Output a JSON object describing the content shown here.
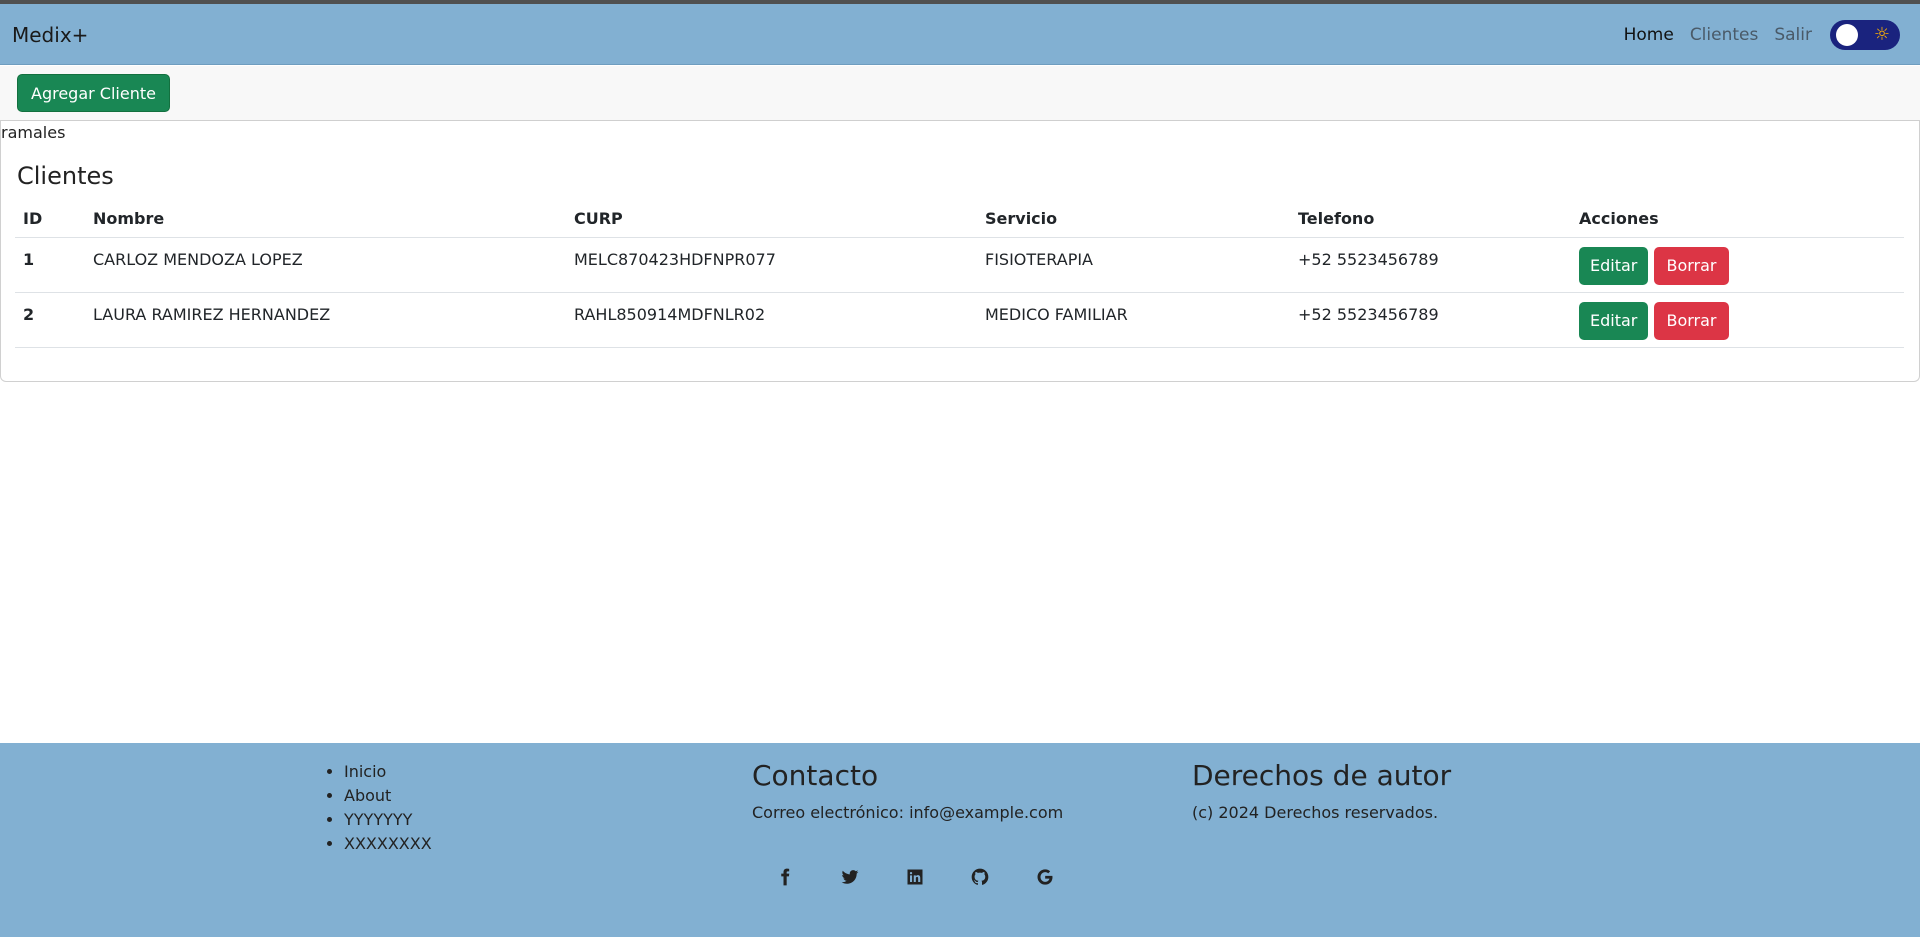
{
  "navbar": {
    "brand": "Medix+",
    "links": [
      "Home",
      "Clientes",
      "Salir"
    ],
    "toggle_icon": "sun-icon"
  },
  "toolbar": {
    "add_label": "Agregar Cliente"
  },
  "user": {
    "name": "ramales"
  },
  "clients": {
    "title": "Clientes",
    "columns": [
      "ID",
      "Nombre",
      "CURP",
      "Servicio",
      "Telefono",
      "Acciones"
    ],
    "rows": [
      {
        "id": "1",
        "nombre": "CARLOZ MENDOZA LOPEZ",
        "curp": "MELC870423HDFNPR077",
        "servicio": "FISIOTERAPIA",
        "telefono": "+52 5523456789",
        "edit": "Editar",
        "delete": "Borrar"
      },
      {
        "id": "2",
        "nombre": "LAURA RAMIREZ HERNANDEZ",
        "curp": "RAHL850914MDFNLR02",
        "servicio": "MEDICO FAMILIAR",
        "telefono": "+52 5523456789",
        "edit": "Editar",
        "delete": "Borrar"
      }
    ]
  },
  "footer": {
    "links": [
      "Inicio",
      "About",
      "YYYYYYY",
      "XXXXXXXX"
    ],
    "contact_title": "Contacto",
    "contact_text": "Correo electrónico: info@example.com",
    "rights_title": "Derechos de autor",
    "rights_text": "(c) 2024 Derechos reservados.",
    "social_icons": [
      "facebook-icon",
      "twitter-icon",
      "linkedin-icon",
      "github-icon",
      "google-icon"
    ]
  },
  "colors": {
    "navbar_bg": "#82b0d2",
    "success": "#198754",
    "danger": "#dc3545",
    "toggle_bg": "#1a237e"
  }
}
